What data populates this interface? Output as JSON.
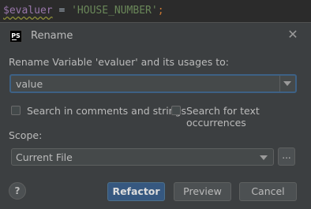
{
  "editor": {
    "variable": "$evaluer",
    "operator": " = ",
    "string": "'HOUSE_NUMBER'",
    "semicolon": ";"
  },
  "dialog": {
    "logo_text": "PS",
    "title": "Rename",
    "prompt": "Rename Variable 'evaluer' and its usages to:",
    "new_name_value": "value",
    "options": {
      "search_comments_label": "Search in comments and strings",
      "search_comments_checked": false,
      "search_text_label": "Search for text occurrences",
      "search_text_checked": false
    },
    "scope_label": "Scope:",
    "scope_value": "Current File",
    "ellipsis": "...",
    "help": "?",
    "buttons": {
      "refactor": "Refactor",
      "preview": "Preview",
      "cancel": "Cancel"
    }
  },
  "colors": {
    "editor_bg": "#2b2b2b",
    "dialog_bg": "#3c3f41",
    "primary_button": "#365880",
    "focus_border": "#3d6185"
  }
}
